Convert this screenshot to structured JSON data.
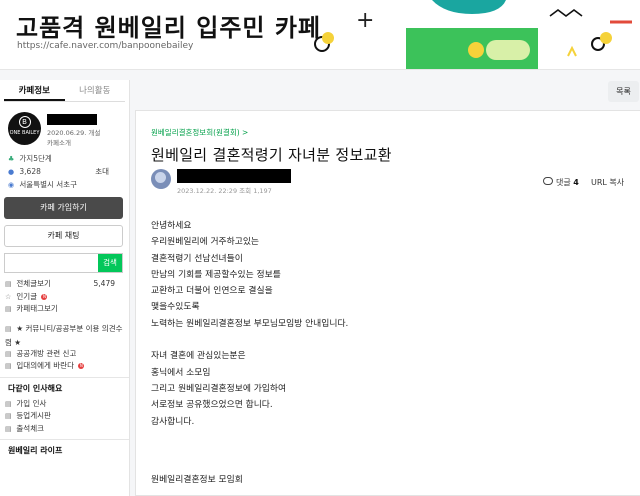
{
  "banner": {
    "title": "고품격 원베일리 입주민 카페",
    "url": "https://cafe.naver.com/banpoonebailey",
    "plus": "+"
  },
  "sidebar": {
    "tabs": [
      "카페정보",
      "나의활동"
    ],
    "logo_text": "ONE BAILEY",
    "founded": "2020.06.29. 개설",
    "intro_link": "카페소개",
    "level": "가지5단계",
    "members": "3,628",
    "invite": "초대",
    "location": "서울특별시 서초구",
    "join_button": "카페 가입하기",
    "chat_button": "카페 채팅",
    "search_placeholder": "",
    "search_button": "검색",
    "menu": [
      {
        "label": "전체글보기",
        "count": "5,479"
      },
      {
        "label": "인기글"
      },
      {
        "label": "카페태그보기"
      }
    ],
    "notices": [
      "★ 커뮤니티/공공부분 이용 의견수렴 ★",
      "공공개방 관련 신고",
      "입대의에게 바란다"
    ],
    "section1": "다같이 인사해요",
    "section1_items": [
      "가입 인사",
      "등업게시판",
      "출석체크"
    ],
    "section2": "원베일리 라이프"
  },
  "toolbar": {
    "list_button": "목록"
  },
  "article": {
    "board": "원베일리결혼정보회(원결회) >",
    "title": "원베일리 결혼적령기 자녀분 정보교환",
    "date": "2023.12.22. 22:29",
    "views_label": "조회 1,197",
    "comments_label": "댓글",
    "comments_count": "4",
    "url_copy": "URL 복사",
    "paragraph1": [
      "안녕하세요",
      "우리원베일리에 거주하고있는",
      "결혼적령기 선남선녀들이",
      "만남의 기회를 제공할수있는 정보를",
      "교환하고 더불어 인연으로 결실을",
      "맺을수있도록",
      "노력하는 원베일리결혼정보 부모님모임방 안내입니다."
    ],
    "paragraph2": [
      "자녀 결혼에 관심있는분은",
      "홍닉에서 소모임",
      "그리고 원베일리결혼정보에 가입하여",
      "서로정보 공유했으었으면 합니다.",
      "감사합니다."
    ],
    "signature": "원베일리결혼정보 모임회"
  },
  "colors": {
    "accent": "#03c75a",
    "deco_yellow": "#f5d23a",
    "deco_teal": "#1aa6a0"
  }
}
